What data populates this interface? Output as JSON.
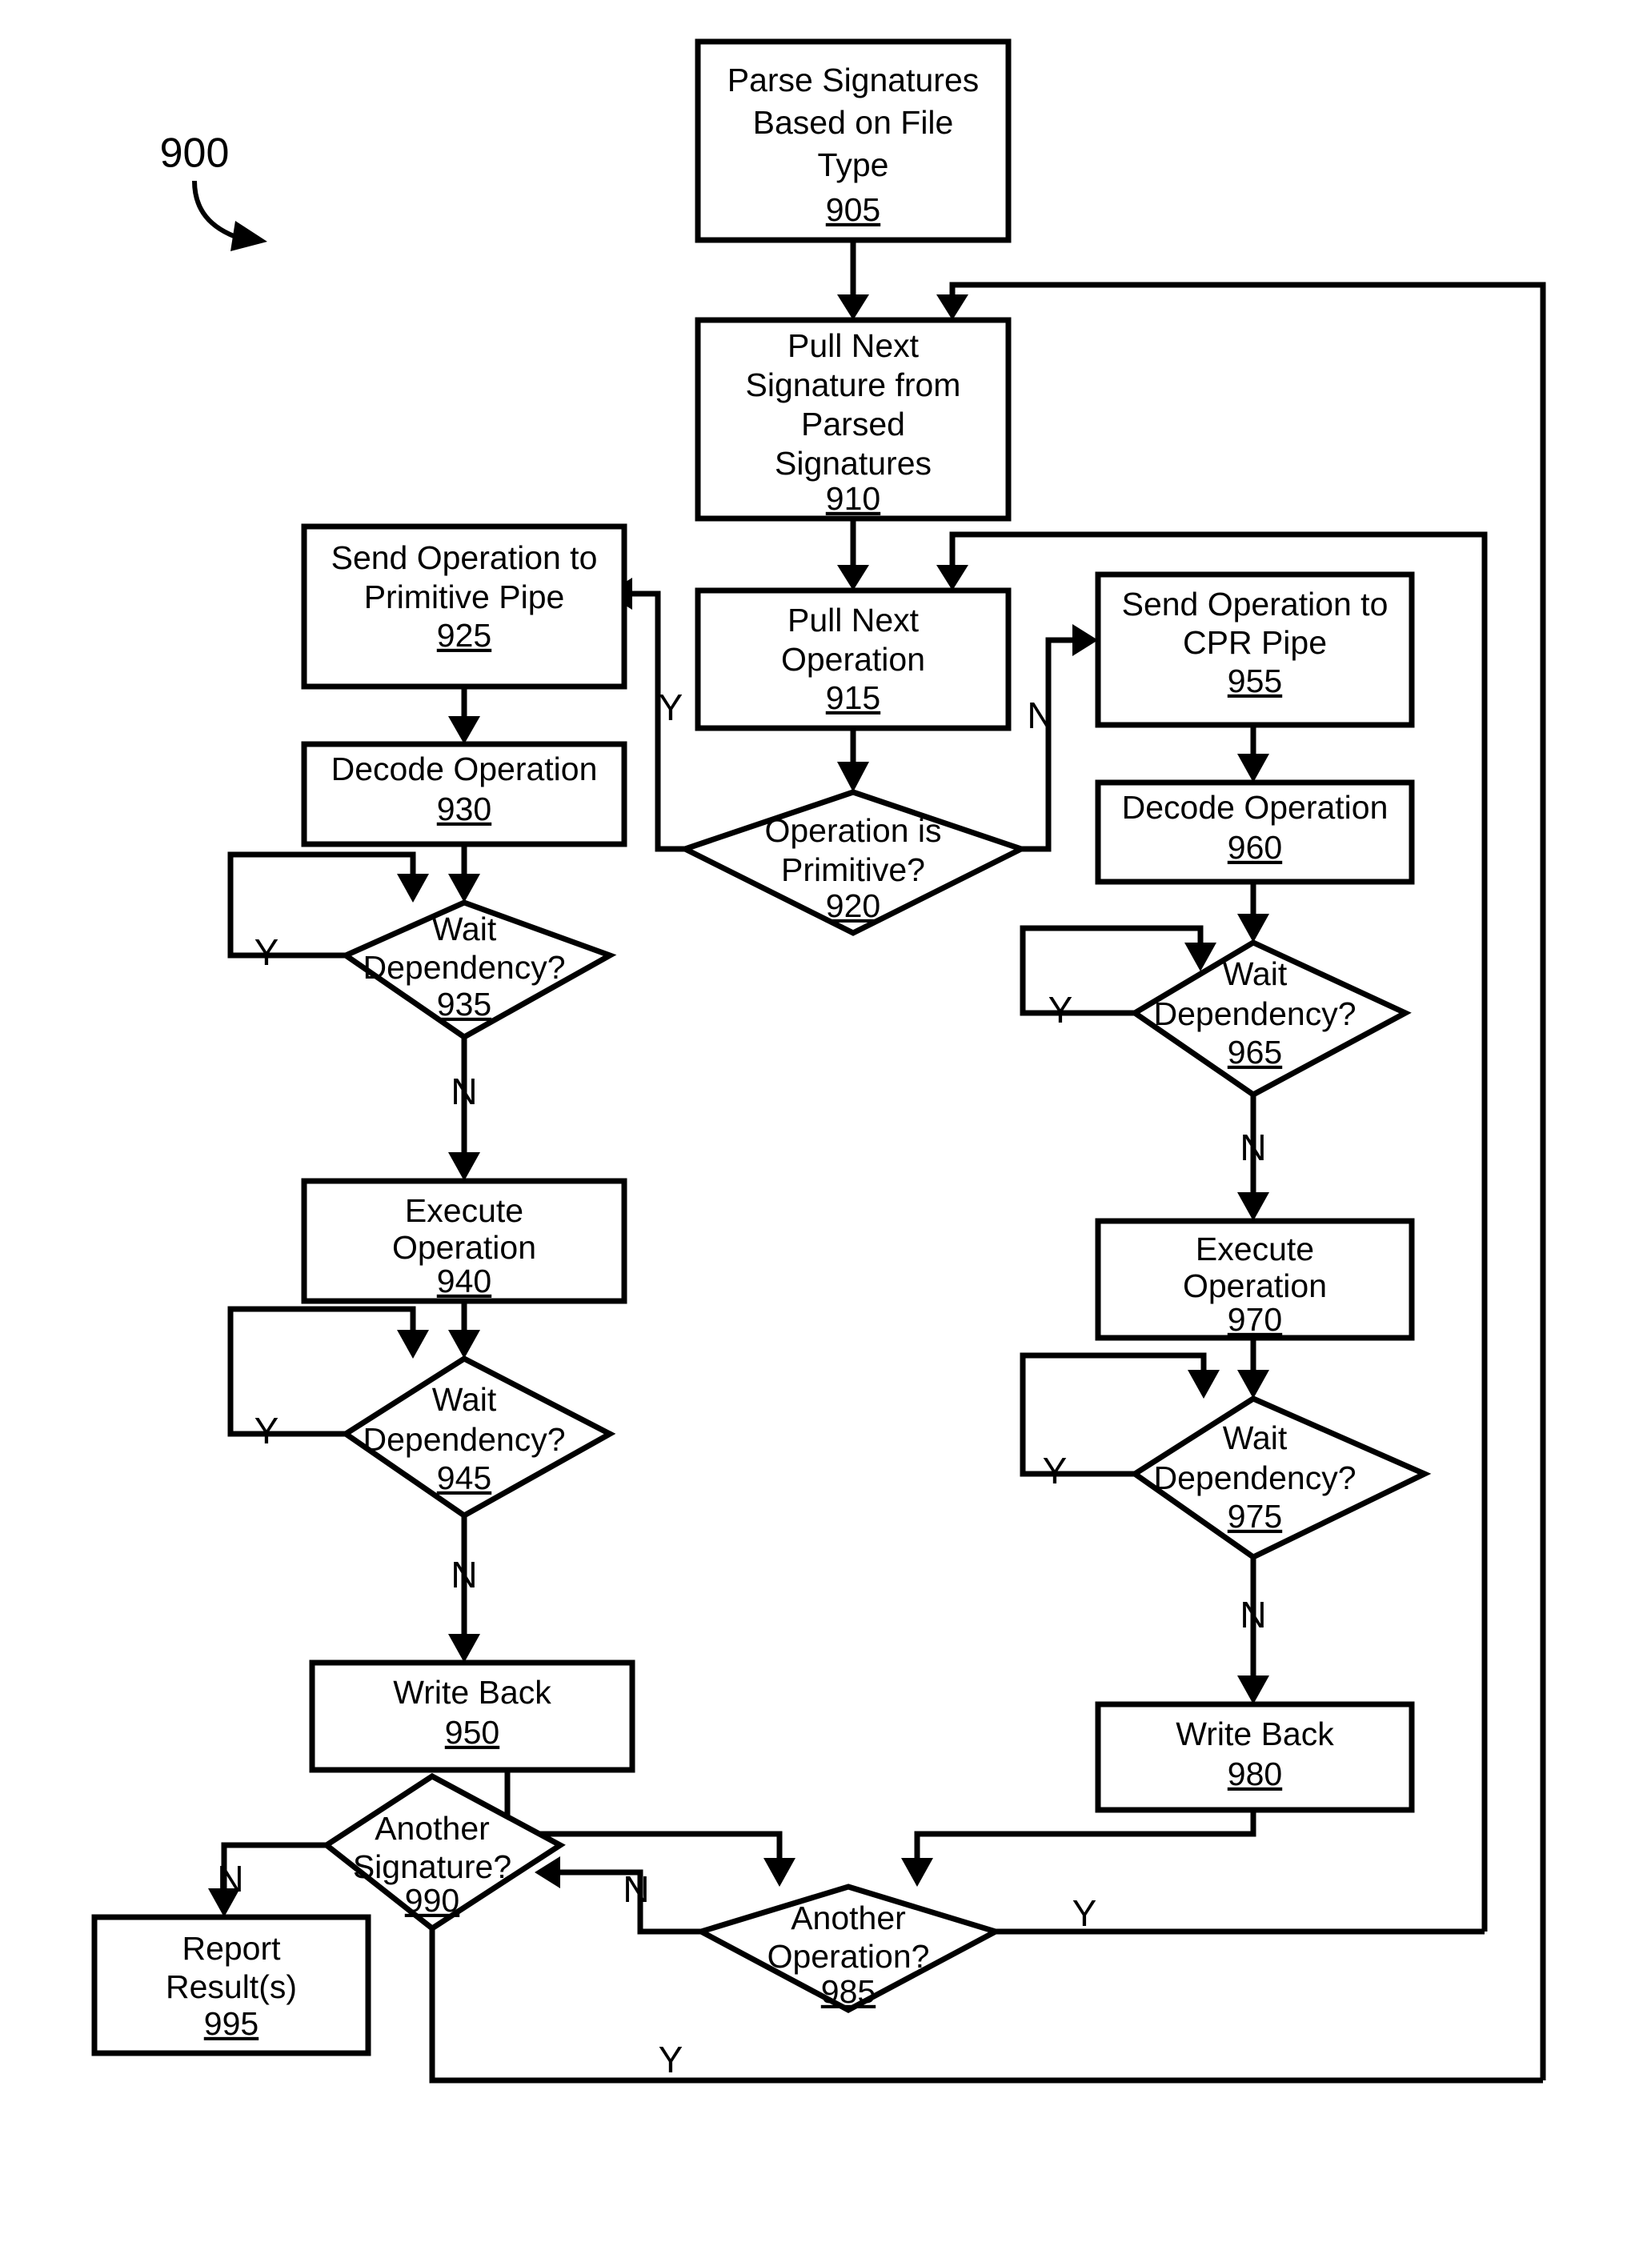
{
  "figure": {
    "number": "900",
    "type": "flowchart",
    "title": "Signature processing flowchart"
  },
  "nodes": [
    {
      "id": "n905",
      "ref": "905",
      "shape": "process",
      "lines": [
        "Parse Signatures",
        "Based on File",
        "Type"
      ]
    },
    {
      "id": "n910",
      "ref": "910",
      "shape": "process",
      "lines": [
        "Pull Next",
        "Signature from",
        "Parsed",
        "Signatures"
      ]
    },
    {
      "id": "n915",
      "ref": "915",
      "shape": "process",
      "lines": [
        "Pull Next",
        "Operation"
      ]
    },
    {
      "id": "n920",
      "ref": "920",
      "shape": "decision",
      "lines": [
        "Operation is",
        "Primitive?"
      ]
    },
    {
      "id": "n925",
      "ref": "925",
      "shape": "process",
      "lines": [
        "Send Operation to",
        "Primitive Pipe"
      ]
    },
    {
      "id": "n930",
      "ref": "930",
      "shape": "process",
      "lines": [
        "Decode Operation"
      ]
    },
    {
      "id": "n935",
      "ref": "935",
      "shape": "decision",
      "lines": [
        "Wait",
        "Dependency?"
      ]
    },
    {
      "id": "n940",
      "ref": "940",
      "shape": "process",
      "lines": [
        "Execute",
        "Operation"
      ]
    },
    {
      "id": "n945",
      "ref": "945",
      "shape": "decision",
      "lines": [
        "Wait",
        "Dependency?"
      ]
    },
    {
      "id": "n950",
      "ref": "950",
      "shape": "process",
      "lines": [
        "Write Back"
      ]
    },
    {
      "id": "n955",
      "ref": "955",
      "shape": "process",
      "lines": [
        "Send Operation to",
        "CPR Pipe"
      ]
    },
    {
      "id": "n960",
      "ref": "960",
      "shape": "process",
      "lines": [
        "Decode Operation"
      ]
    },
    {
      "id": "n965",
      "ref": "965",
      "shape": "decision",
      "lines": [
        "Wait",
        "Dependency?"
      ]
    },
    {
      "id": "n970",
      "ref": "970",
      "shape": "process",
      "lines": [
        "Execute",
        "Operation"
      ]
    },
    {
      "id": "n975",
      "ref": "975",
      "shape": "decision",
      "lines": [
        "Wait",
        "Dependency?"
      ]
    },
    {
      "id": "n980",
      "ref": "980",
      "shape": "process",
      "lines": [
        "Write Back"
      ]
    },
    {
      "id": "n985",
      "ref": "985",
      "shape": "decision",
      "lines": [
        "Another",
        "Operation?"
      ]
    },
    {
      "id": "n990",
      "ref": "990",
      "shape": "decision",
      "lines": [
        "Another",
        "Signature?"
      ]
    },
    {
      "id": "n995",
      "ref": "995",
      "shape": "process",
      "lines": [
        "Report",
        "Result(s)"
      ]
    }
  ],
  "branch_labels": {
    "b920_yes": "Y",
    "b920_no": "N",
    "b935_yes": "Y",
    "b935_no": "N",
    "b945_yes": "Y",
    "b945_no": "N",
    "b965_yes": "Y",
    "b965_no": "N",
    "b975_yes": "Y",
    "b975_no": "N",
    "b985_yes_right": "Y",
    "b985_no_left": "N",
    "b990_no_left": "N",
    "b990_yes_bottom": "Y"
  },
  "colors": {
    "stroke": "#000000",
    "fill": "#ffffff",
    "background": "#ffffff"
  }
}
